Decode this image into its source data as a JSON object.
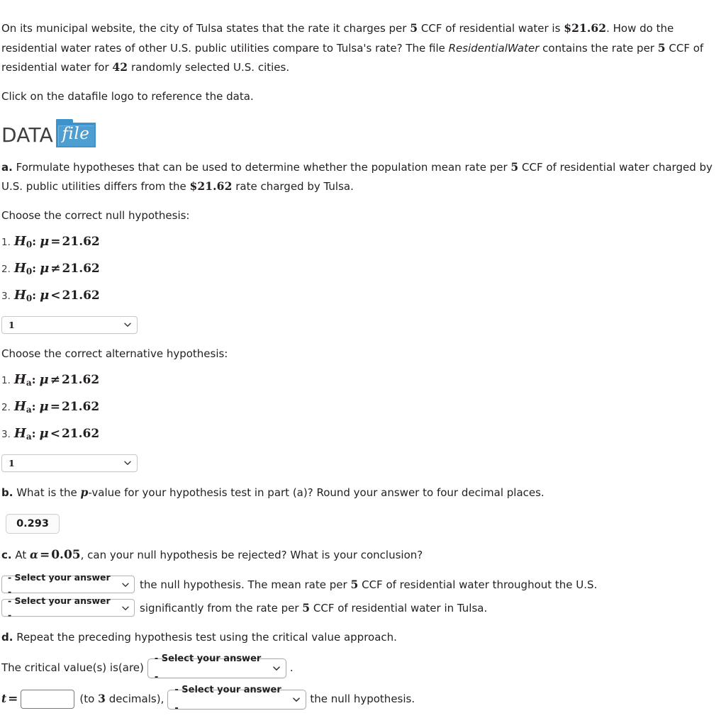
{
  "problem": {
    "intro_1": "On its municipal website, the city of Tulsa states that the rate it charges per ",
    "intro_n1": "5",
    "intro_2": " CCF of residential water is ",
    "intro_rate": "$21.62",
    "intro_3": ". How do the residential water rates of other U.S. public utilities compare to Tulsa's rate? The file ",
    "file_name": "ResidentialWater",
    "intro_4": " contains the rate per ",
    "intro_n2": "5",
    "intro_5": " CCF of residential water for ",
    "intro_n3": "42",
    "intro_6": " randomly selected U.S. cities.",
    "click_instruction": "Click on the datafile logo to reference the data."
  },
  "datafile": {
    "label": "DATA",
    "folder_text": "file",
    "folder_color": "#3f93cb",
    "folder_inner_color": "#4e9ed2",
    "text_color": "#404040"
  },
  "part_a": {
    "marker": "a.",
    "text_1": " Formulate hypotheses that can be used to determine whether the population mean rate per ",
    "n1": "5",
    "text_2": " CCF of residential water charged by U.S. public utilities differs from the ",
    "rate": "$21.62",
    "text_3": " rate charged by Tulsa.",
    "null_prompt": "Choose the correct null hypothesis:",
    "null_options": [
      {
        "num": "1.",
        "sym": "H",
        "sub": "0",
        "colon": ":",
        "mu": "μ",
        "op": "=",
        "val": "21.62"
      },
      {
        "num": "2.",
        "sym": "H",
        "sub": "0",
        "colon": ":",
        "mu": "μ",
        "op": "≠",
        "val": "21.62"
      },
      {
        "num": "3.",
        "sym": "H",
        "sub": "0",
        "colon": ":",
        "mu": "μ",
        "op": "<",
        "val": "21.62"
      }
    ],
    "null_select_value": "1",
    "alt_prompt": "Choose the correct alternative hypothesis:",
    "alt_options": [
      {
        "num": "1.",
        "sym": "H",
        "sub": "a",
        "colon": ":",
        "mu": "μ",
        "op": "≠",
        "val": "21.62"
      },
      {
        "num": "2.",
        "sym": "H",
        "sub": "a",
        "colon": ":",
        "mu": "μ",
        "op": "=",
        "val": "21.62"
      },
      {
        "num": "3.",
        "sym": "H",
        "sub": "a",
        "colon": ":",
        "mu": "μ",
        "op": "<",
        "val": "21.62"
      }
    ],
    "alt_select_value": "1"
  },
  "part_b": {
    "marker": "b.",
    "text_1": " What is the ",
    "p_sym": "p",
    "text_2": "-value for your hypothesis test in part (a)? Round your answer to four decimal places.",
    "pvalue": "0.293"
  },
  "part_c": {
    "marker": "c.",
    "text_1": " At ",
    "alpha": "α",
    "eq": "=",
    "alpha_val": "0.05",
    "text_2": ", can your null hypothesis be rejected? What is your conclusion?",
    "select_1": "- Select your answer -",
    "line_1a": "the null hypothesis. The mean rate per ",
    "line_1n": "5",
    "line_1b": " CCF of residential water throughout the U.S.",
    "select_2": "- Select your answer -",
    "line_2a": "significantly from the rate per ",
    "line_2n": "5",
    "line_2b": " CCF of residential water in Tulsa."
  },
  "part_d": {
    "marker": "d.",
    "text_1": " Repeat the preceding hypothesis test using the critical value approach.",
    "crit_label": "The critical value(s) is(are)",
    "crit_select": "- Select your answer -",
    "period": ".",
    "t_sym": "t",
    "t_eq": "=",
    "t_value": "",
    "decimals_1": "(to ",
    "decimals_n": "3",
    "decimals_2": " decimals),",
    "reject_select": "- Select your answer -",
    "reject_text": "the null hypothesis."
  },
  "icons": {
    "chevron": "chevron-down-icon"
  }
}
